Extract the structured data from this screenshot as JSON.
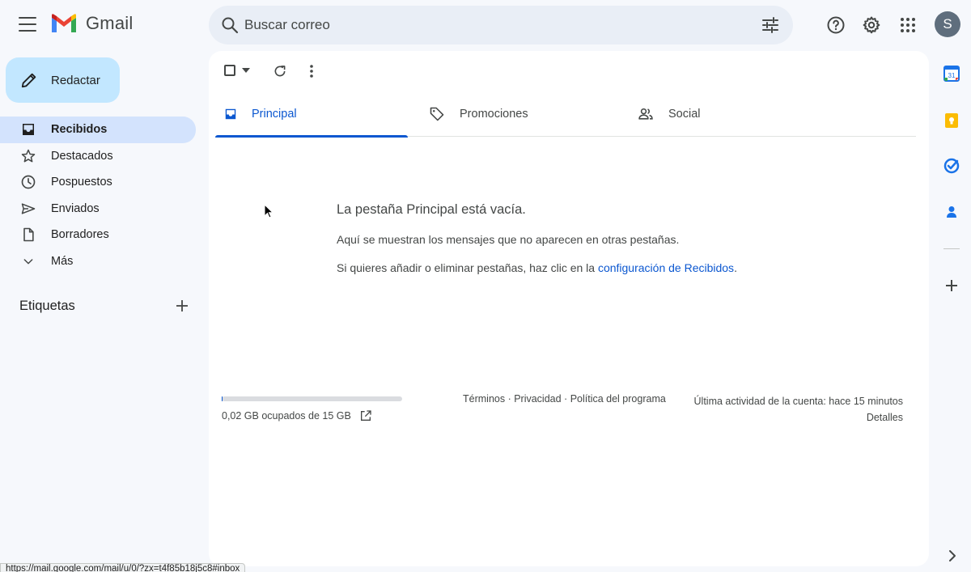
{
  "header": {
    "app_name": "Gmail",
    "search_placeholder": "Buscar correo",
    "avatar_initial": "S"
  },
  "compose": {
    "label": "Redactar"
  },
  "nav": {
    "items": [
      {
        "label": "Recibidos",
        "icon": "inbox-icon",
        "active": true
      },
      {
        "label": "Destacados",
        "icon": "star-icon"
      },
      {
        "label": "Pospuestos",
        "icon": "clock-icon"
      },
      {
        "label": "Enviados",
        "icon": "send-icon"
      },
      {
        "label": "Borradores",
        "icon": "draft-icon"
      },
      {
        "label": "Más",
        "icon": "chevron-down-icon"
      }
    ]
  },
  "labels": {
    "title": "Etiquetas"
  },
  "tabs": [
    {
      "label": "Principal",
      "icon": "inbox-icon",
      "active": true
    },
    {
      "label": "Promociones",
      "icon": "tag-icon"
    },
    {
      "label": "Social",
      "icon": "people-icon"
    }
  ],
  "empty_state": {
    "title": "La pestaña Principal está vacía.",
    "line1": "Aquí se muestran los mensajes que no aparecen en otras pestañas.",
    "line2_prefix": "Si quieres añadir o eliminar pestañas, haz clic en la ",
    "line2_link": "configuración de Recibidos",
    "line2_suffix": "."
  },
  "footer": {
    "storage_text": "0,02 GB ocupados de 15 GB",
    "storage_fraction": 0.0013,
    "terms": "Términos",
    "privacy": "Privacidad",
    "program_policy": "Política del programa",
    "separator": " · ",
    "last_activity": "Última actividad de la cuenta: hace 15 minutos",
    "details": "Detalles"
  },
  "side_panel": {
    "calendar_day": "31"
  },
  "status_bar": {
    "url": "https://mail.google.com/mail/u/0/?zx=t4f85b18j5c8#inbox"
  },
  "colors": {
    "accent": "#0b57d0",
    "compose_bg": "#c2e7ff",
    "active_nav_bg": "#d3e3fd",
    "app_bg": "#f6f8fc"
  }
}
